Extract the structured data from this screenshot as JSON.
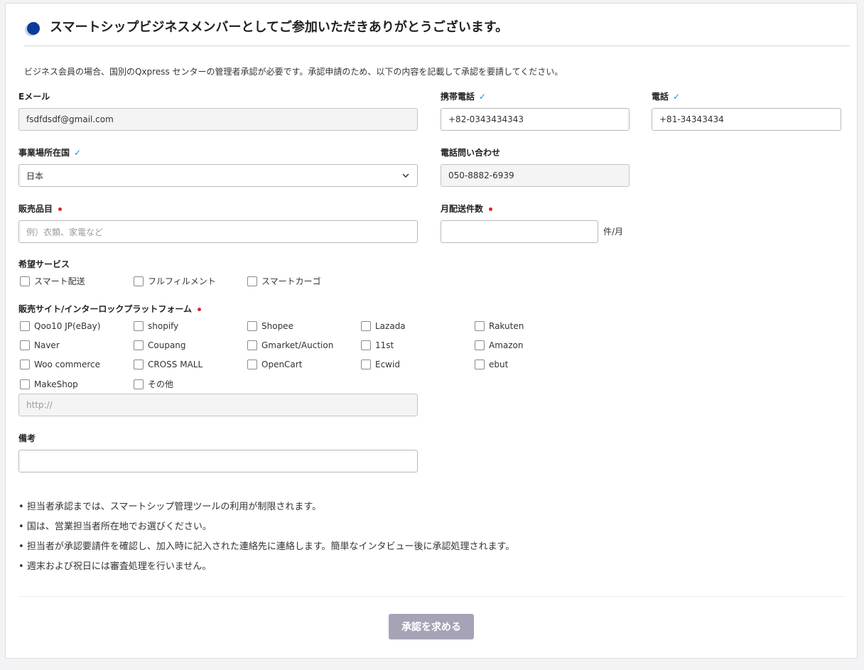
{
  "header": {
    "title": "スマートシップビジネスメンバーとしてご参加いただきありがとうございます。",
    "description": "ビジネス会員の場合、国別のQxpress センターの管理者承認が必要です。承認申請のため、以下の内容を記載して承認を要請してください。"
  },
  "fields": {
    "email": {
      "label": "Eメール",
      "value": "fsdfdsdf@gmail.com"
    },
    "mobile": {
      "label": "携帯電話",
      "value": "+82-0343434343"
    },
    "phone": {
      "label": "電話",
      "value": "+81-34343434"
    },
    "country": {
      "label": "事業場所在国",
      "value": "日本"
    },
    "inquiry_phone": {
      "label": "電話問い合わせ",
      "value": "050-8882-6939"
    },
    "products": {
      "label": "販売品目",
      "placeholder": "例）衣類、家電など",
      "value": ""
    },
    "monthly_shipments": {
      "label": "月配送件数",
      "value": "",
      "unit": "件/月"
    },
    "remarks": {
      "label": "備考",
      "value": ""
    }
  },
  "services": {
    "label": "希望サービス",
    "options": [
      "スマート配送",
      "フルフィルメント",
      "スマートカーゴ"
    ]
  },
  "platforms": {
    "label": "販売サイト/インターロックプラットフォーム",
    "options": [
      "Qoo10 JP(eBay)",
      "shopify",
      "Shopee",
      "Lazada",
      "Rakuten",
      "Naver",
      "Coupang",
      "Gmarket/Auction",
      "11st",
      "Amazon",
      "Woo commerce",
      "CROSS MALL",
      "OpenCart",
      "Ecwid",
      "ebut",
      "MakeShop",
      "その他"
    ],
    "url_placeholder": "http://"
  },
  "notes": [
    "担当者承認までは、スマートシップ管理ツールの利用が制限されます。",
    "国は、営業担当者所在地でお選びください。",
    "担当者が承認要請件を確認し、加入時に記入された連絡先に連絡します。簡単なインタビュー後に承認処理されます。",
    "週末および祝日には審査処理を行いません。"
  ],
  "submit_label": "承認を求める",
  "colors": {
    "accent": "#1f8fd6",
    "required": "#d9262c",
    "button": "#a7a3b6",
    "logo": "#0b3c9c"
  }
}
